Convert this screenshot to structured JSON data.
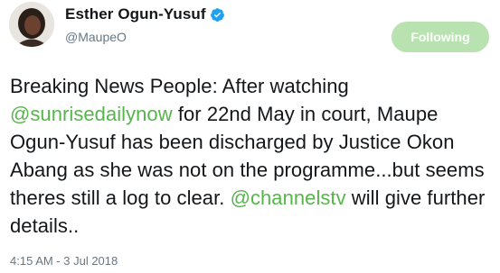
{
  "user": {
    "display_name": "Esther Ogun-Yusuf",
    "handle": "@MaupeO",
    "verified_icon": "verified-badge-icon"
  },
  "follow_button": {
    "label": "Following"
  },
  "tweet": {
    "part1": "Breaking News People: After watching ",
    "mention1": "@sunrisedailynow",
    "part2": " for 22nd May in court, Maupe Ogun-Yusuf has been discharged by Justice Okon Abang as she was not on the programme...but seems theres still a log to clear. ",
    "mention2": "@channelstv",
    "part3": " will give further details.."
  },
  "timestamp": "4:15 AM - 3 Jul 2018",
  "colors": {
    "mention": "#56b54b",
    "follow_button_bg": "#b8e2b0",
    "verified": "#1da1f2"
  }
}
